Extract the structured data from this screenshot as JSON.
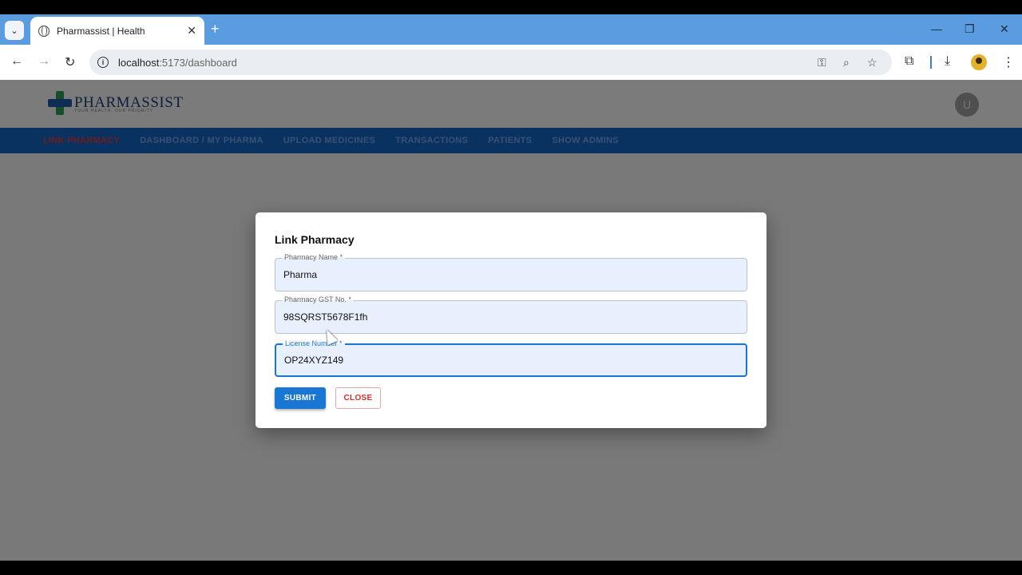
{
  "browser": {
    "tab_title": "Pharmassist | Health",
    "tab_close": "✕",
    "new_tab": "+",
    "url_host": "localhost",
    "url_rest": ":5173/dashboard",
    "window_min": "—",
    "window_restore": "❐",
    "window_close": "✕"
  },
  "header": {
    "logo_text": "PHARMASSIST",
    "logo_tagline": "YOUR HEALTH, OUR PRIORITY",
    "user_initial": "U"
  },
  "nav": {
    "items": [
      {
        "label": "LINK PHARMACY",
        "active": true
      },
      {
        "label": "DASHBOARD / MY PHARMA",
        "active": false
      },
      {
        "label": "UPLOAD MEDICINES",
        "active": false
      },
      {
        "label": "TRANSACTIONS",
        "active": false
      },
      {
        "label": "PATIENTS",
        "active": false
      },
      {
        "label": "SHOW ADMINS",
        "active": false
      }
    ]
  },
  "dialog": {
    "title": "Link Pharmacy",
    "fields": [
      {
        "label": "Pharmacy Name *",
        "value": "Pharma"
      },
      {
        "label": "Pharmacy GST No. *",
        "value": "98SQRST5678F1fh"
      },
      {
        "label": "License Number *",
        "value": "OP24XYZ149"
      }
    ],
    "submit_label": "SUBMIT",
    "close_label": "CLOSE"
  },
  "colors": {
    "nav_bg": "#1565c0",
    "active_nav": "#e53935",
    "primary": "#1976d2",
    "danger": "#d32f2f"
  }
}
